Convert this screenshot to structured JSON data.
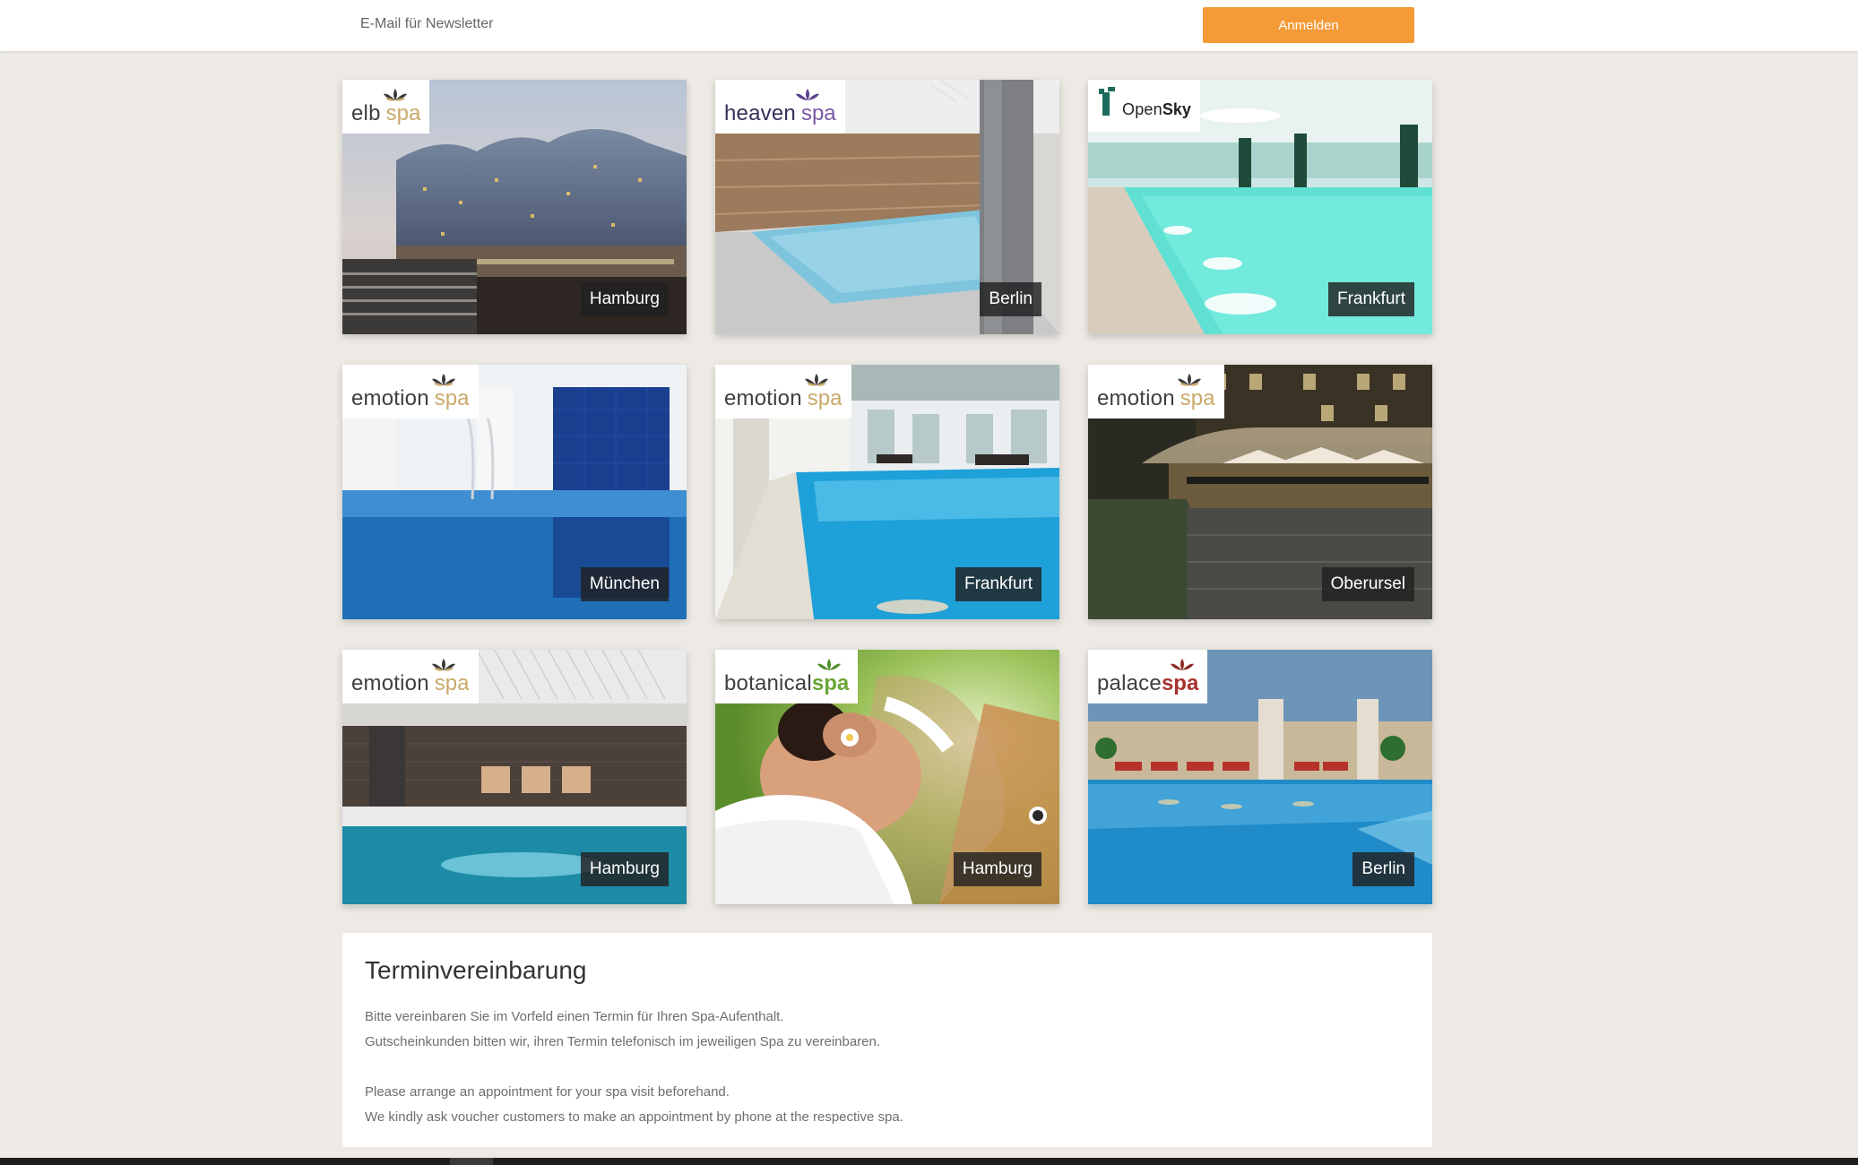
{
  "newsletter": {
    "placeholder": "E-Mail für Newsletter",
    "button_label": "Anmelden"
  },
  "spas": [
    {
      "logo_a": "elb",
      "logo_b": "spa",
      "logo_b_color": "#c9a96a",
      "lotus_color": "#3b3b3b",
      "city": "Hamburg",
      "scene": "elbphilharmonie"
    },
    {
      "logo_a": "heaven",
      "logo_b": "spa",
      "logo_b_color": "#7b5aa6",
      "lotus_color": "#5b3f8c",
      "city": "Berlin",
      "scene": "pool-stone"
    },
    {
      "logo_a": "Open",
      "logo_b": "Sky",
      "logo_b_color": "#222222",
      "lotus_color": "#1d6b5c",
      "city": "Frankfurt",
      "scene": "pool-turquoise"
    },
    {
      "logo_a": "emotion",
      "logo_b": "spa",
      "logo_b_color": "#c9a96a",
      "lotus_color": "#3b3b3b",
      "city": "München",
      "scene": "pool-blue-tiles"
    },
    {
      "logo_a": "emotion",
      "logo_b": "spa",
      "logo_b_color": "#c9a96a",
      "lotus_color": "#3b3b3b",
      "city": "Frankfurt",
      "scene": "pool-bright"
    },
    {
      "logo_a": "emotion",
      "logo_b": "spa",
      "logo_b_color": "#c9a96a",
      "lotus_color": "#3b3b3b",
      "city": "Oberursel",
      "scene": "terrace-night"
    },
    {
      "logo_a": "emotion",
      "logo_b": "spa",
      "logo_b_color": "#c9a96a",
      "lotus_color": "#3b3b3b",
      "city": "Hamburg",
      "scene": "pool-loungers"
    },
    {
      "logo_a": "botanical",
      "logo_b": "spa",
      "logo_b_color": "#6aa536",
      "lotus_color": "#4f8f2a",
      "city": "Hamburg",
      "scene": "massage"
    },
    {
      "logo_a": "palace",
      "logo_b": "spa",
      "logo_b_color": "#a8322e",
      "lotus_color": "#8a2a24",
      "city": "Berlin",
      "scene": "pool-palace"
    }
  ],
  "info": {
    "title": "Terminvereinbarung",
    "line1": "Bitte vereinbaren Sie im Vorfeld einen Termin für Ihren Spa-Aufenthalt.",
    "line2": "Gutscheinkunden bitten wir, ihren Termin telefonisch im jeweiligen Spa zu vereinbaren.",
    "line3": "Please arrange an appointment for your spa visit beforehand.",
    "line4": "We kindly ask voucher customers to make an appointment by phone at the respective spa."
  }
}
